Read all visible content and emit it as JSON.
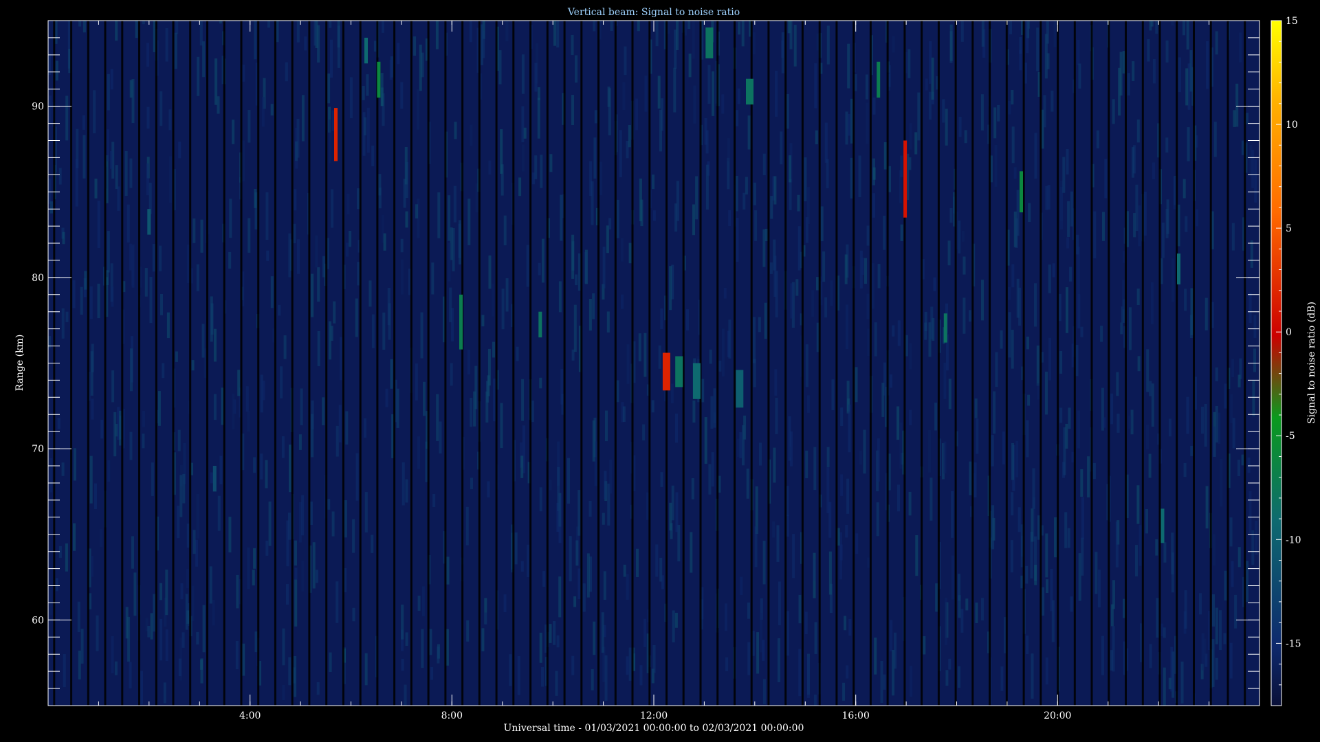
{
  "chart_data": {
    "type": "heatmap",
    "title": "Vertical beam: Signal to noise ratio",
    "xlabel": "Universal time - 01/03/2021 00:00:00 to 02/03/2021 00:00:00",
    "ylabel": "Range (km)",
    "colorbar_label": "Signal to noise ratio (dB)",
    "x_unit": "hours UT",
    "xlim": [
      0,
      24
    ],
    "ylim": [
      55,
      95
    ],
    "clim": [
      -18,
      15
    ],
    "x_ticks": [
      4,
      8,
      12,
      16,
      20
    ],
    "x_tick_labels": [
      "4:00",
      "8:00",
      "12:00",
      "16:00",
      "20:00"
    ],
    "y_ticks": [
      60,
      70,
      80,
      90
    ],
    "y_tick_labels": [
      "60",
      "70",
      "80",
      "90"
    ],
    "colorbar_ticks": [
      15,
      10,
      5,
      0,
      -5,
      -10,
      -15
    ],
    "colorbar_tick_labels": [
      "15",
      "10",
      "5",
      "0",
      "-5",
      "-10",
      "-15"
    ],
    "background_snr": -16,
    "features": [
      {
        "t": 5.7,
        "range": [
          86.8,
          89.9
        ],
        "snr": 2
      },
      {
        "t": 6.55,
        "range": [
          90.5,
          92.6
        ],
        "snr": -6
      },
      {
        "t": 6.3,
        "range": [
          92.5,
          94.0
        ],
        "snr": -9
      },
      {
        "t": 8.18,
        "range": [
          75.8,
          79.0
        ],
        "snr": -7
      },
      {
        "t": 9.75,
        "range": [
          76.5,
          78.0
        ],
        "snr": -8
      },
      {
        "t": 12.25,
        "range": [
          73.4,
          75.6
        ],
        "snr": 2
      },
      {
        "t": 12.5,
        "range": [
          73.6,
          75.4
        ],
        "snr": -8
      },
      {
        "t": 12.85,
        "range": [
          72.9,
          75.0
        ],
        "snr": -9
      },
      {
        "t": 13.7,
        "range": [
          72.4,
          74.6
        ],
        "snr": -10
      },
      {
        "t": 13.1,
        "range": [
          92.8,
          94.6
        ],
        "snr": -8
      },
      {
        "t": 13.9,
        "range": [
          90.1,
          91.6
        ],
        "snr": -8
      },
      {
        "t": 16.45,
        "range": [
          90.5,
          92.6
        ],
        "snr": -7
      },
      {
        "t": 16.98,
        "range": [
          83.5,
          88.0
        ],
        "snr": 1
      },
      {
        "t": 17.78,
        "range": [
          76.2,
          77.9
        ],
        "snr": -8
      },
      {
        "t": 19.28,
        "range": [
          83.8,
          86.2
        ],
        "snr": -6
      },
      {
        "t": 22.08,
        "range": [
          64.5,
          66.5
        ],
        "snr": -9
      },
      {
        "t": 22.4,
        "range": [
          79.6,
          81.4
        ],
        "snr": -9
      },
      {
        "t": 2.0,
        "range": [
          82.5,
          84.0
        ],
        "snr": -11
      },
      {
        "t": 3.3,
        "range": [
          67.5,
          69.0
        ],
        "snr": -12
      }
    ]
  }
}
